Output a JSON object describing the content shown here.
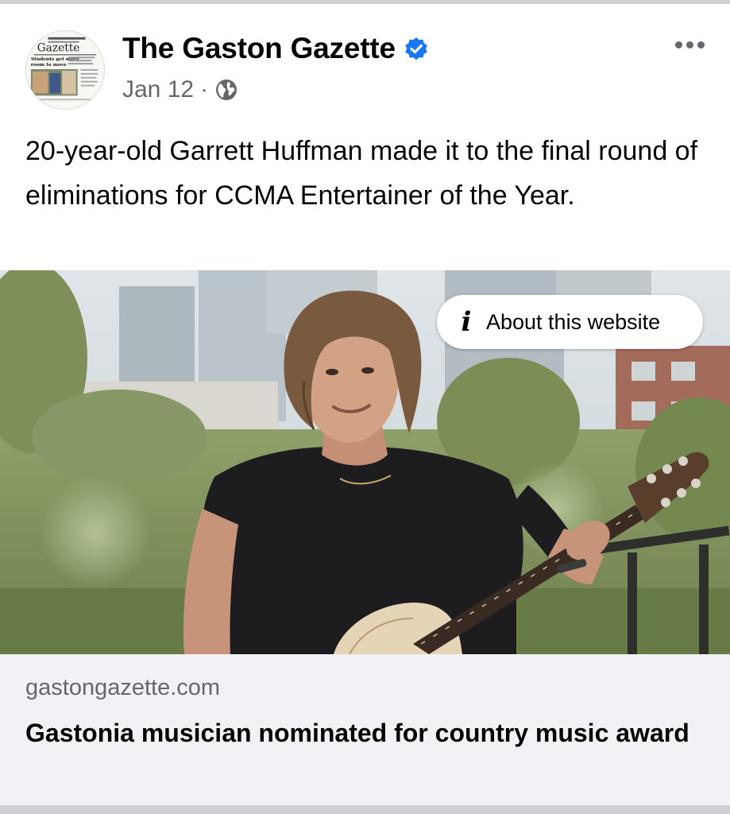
{
  "post": {
    "page_name": "The Gaston Gazette",
    "date": "Jan 12",
    "separator": "·",
    "avatar_masthead": "Gazette",
    "avatar_headline": "Students get more room to move",
    "verified": true,
    "audience_icon": "globe-icon",
    "caption": "20-year-old Garrett Huffman made it to the final round of eliminations for CCMA Entertainer of the Year."
  },
  "image_overlay": {
    "about_label": "About this website",
    "icon": "info-icon"
  },
  "link_preview": {
    "domain": "gastongazette.com",
    "title": "Gastonia musician nominated for country music award"
  },
  "colors": {
    "verified_blue": "#1877f2",
    "secondary_text": "#65676b",
    "link_background": "#f0f2f5"
  }
}
